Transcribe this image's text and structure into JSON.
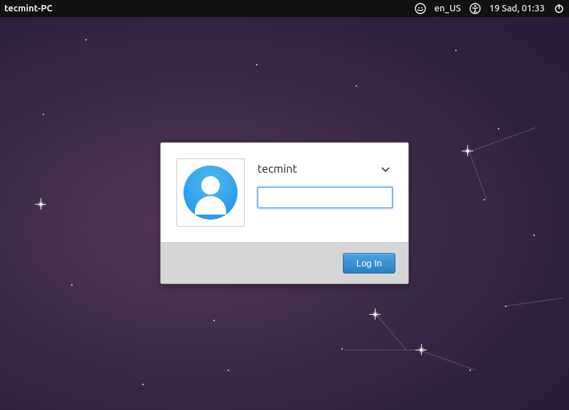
{
  "panel": {
    "hostname": "tecmint-PC",
    "language": "en_US",
    "datetime": "19 Sad, 01:33"
  },
  "login": {
    "username": "tecmint",
    "password_value": "",
    "login_button_label": "Log In"
  }
}
